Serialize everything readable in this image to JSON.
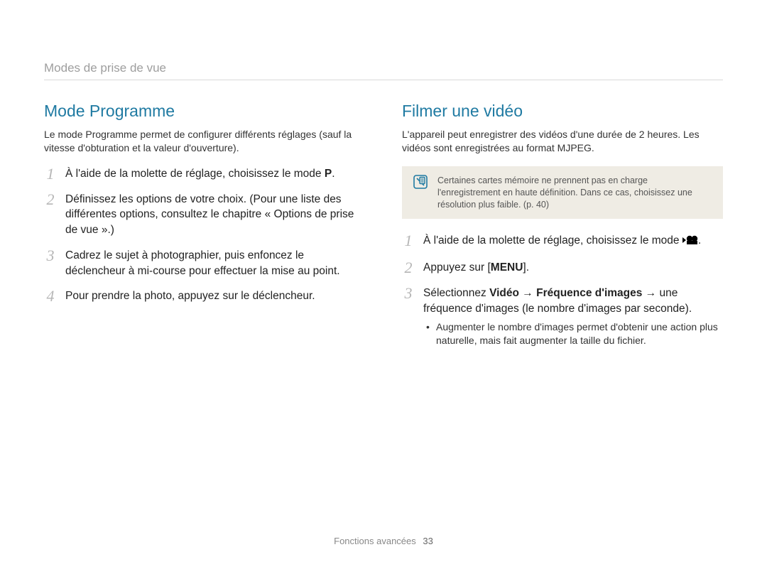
{
  "breadcrumb": "Modes de prise de vue",
  "left": {
    "title": "Mode Programme",
    "intro": "Le mode Programme permet de configurer différents réglages (sauf la vitesse d'obturation et la valeur d'ouverture).",
    "steps": {
      "s1_pre": "À l'aide de la molette de réglage, choisissez le mode ",
      "s1_icon_label": "P",
      "s1_post": ".",
      "s2": "Définissez les options de votre choix. (Pour une liste des différentes options, consultez le chapitre « Options de prise de vue ».)",
      "s3": "Cadrez le sujet à photographier, puis enfoncez le déclencheur à mi-course pour effectuer la mise au point.",
      "s4": "Pour prendre la photo, appuyez sur le déclencheur."
    },
    "nums": {
      "n1": "1",
      "n2": "2",
      "n3": "3",
      "n4": "4"
    }
  },
  "right": {
    "title": "Filmer une vidéo",
    "intro": "L'appareil peut enregistrer des vidéos d'une durée de 2 heures. Les vidéos sont enregistrées au format MJPEG.",
    "note": "Certaines cartes mémoire ne prennent pas en charge l'enregistrement en haute définition. Dans ce cas, choisissez une résolution plus faible. (p. 40)",
    "steps": {
      "s1_pre": "À l'aide de la molette de réglage, choisissez le mode ",
      "s1_post": ".",
      "s2_pre": "Appuyez sur [",
      "s2_bold": "MENU",
      "s2_post": "].",
      "s3_pre": "Sélectionnez ",
      "s3_b1": "Vidéo",
      "s3_arrow1": " → ",
      "s3_b2": "Fréquence d'images",
      "s3_arrow2": " → ",
      "s3_post": "une fréquence d'images (le nombre d'images par seconde).",
      "bullet": "Augmenter le nombre d'images permet d'obtenir une action plus naturelle, mais fait augmenter la taille du fichier."
    },
    "nums": {
      "n1": "1",
      "n2": "2",
      "n3": "3"
    }
  },
  "footer": {
    "section": "Fonctions avancées",
    "page": "33"
  }
}
